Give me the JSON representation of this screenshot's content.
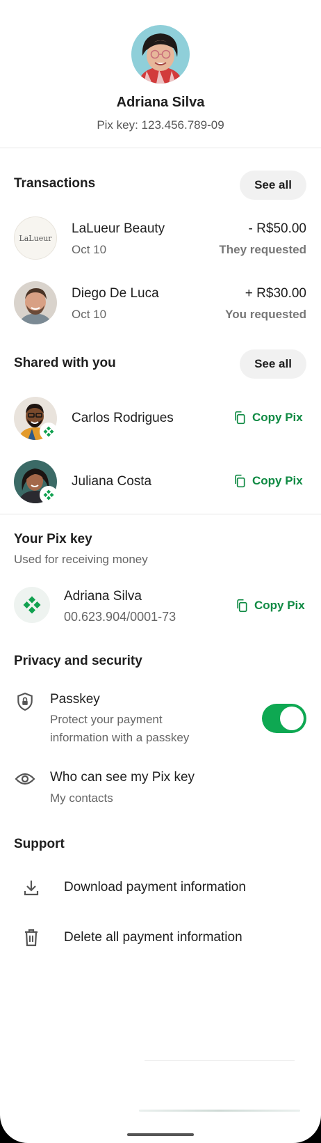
{
  "profile": {
    "name": "Adriana Silva",
    "pix_key_label": "Pix key: 123.456.789-09"
  },
  "transactions": {
    "title": "Transactions",
    "see_all": "See all",
    "items": [
      {
        "name": "LaLueur Beauty",
        "logo_text": "LaLueur",
        "date": "Oct 10",
        "amount": "- R$50.00",
        "status": "They requested"
      },
      {
        "name": "Diego De Luca",
        "date": "Oct 10",
        "amount": "+ R$30.00",
        "status": "You requested"
      }
    ]
  },
  "shared": {
    "title": "Shared with you",
    "see_all": "See all",
    "items": [
      {
        "name": "Carlos Rodrigues",
        "action": "Copy Pix"
      },
      {
        "name": "Juliana Costa",
        "action": "Copy Pix"
      }
    ]
  },
  "your_pix": {
    "title": "Your Pix key",
    "subtitle": "Used for receiving money",
    "name": "Adriana Silva",
    "key": "00.623.904/0001-73",
    "action": "Copy Pix"
  },
  "privacy": {
    "title": "Privacy and security",
    "passkey": {
      "title": "Passkey",
      "desc_line1": "Protect your payment",
      "desc_line2": "information with a passkey",
      "enabled": true
    },
    "visibility": {
      "title": "Who can see my Pix key",
      "value": "My contacts"
    }
  },
  "support": {
    "title": "Support",
    "download": "Download payment information",
    "delete": "Delete all payment information"
  },
  "colors": {
    "accent_green": "#0f8a43",
    "toggle_on": "#0ea852"
  }
}
